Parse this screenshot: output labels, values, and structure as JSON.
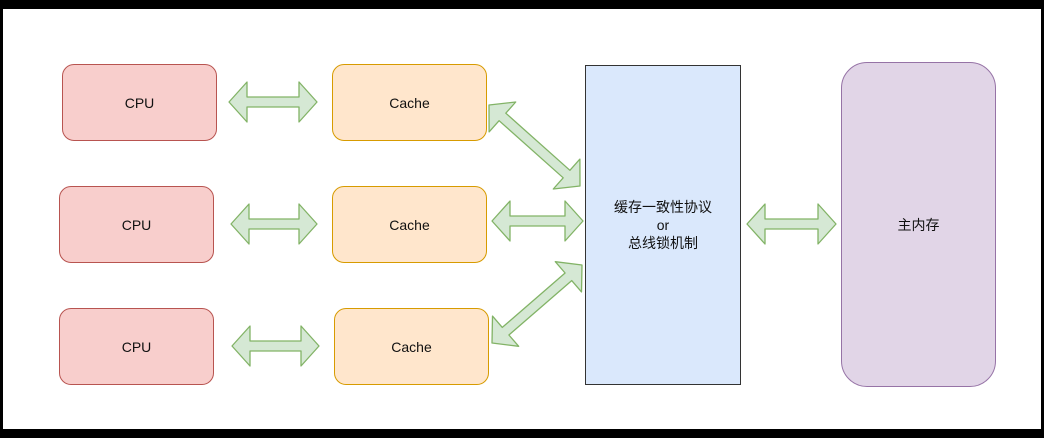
{
  "diagram": {
    "cpus": [
      "CPU",
      "CPU",
      "CPU"
    ],
    "caches": [
      "Cache",
      "Cache",
      "Cache"
    ],
    "protocol": {
      "line1": "缓存一致性协议",
      "line2": "or",
      "line3": "总线锁机制"
    },
    "memory": "主内存"
  },
  "colors": {
    "cpu_fill": "#f8cecc",
    "cpu_stroke": "#b85450",
    "cache_fill": "#ffe6cc",
    "cache_stroke": "#d79b00",
    "protocol_fill": "#dae8fc",
    "memory_fill": "#e1d5e7",
    "memory_stroke": "#9673a6",
    "arrow_fill": "#d5e8d4",
    "arrow_stroke": "#82b366"
  }
}
